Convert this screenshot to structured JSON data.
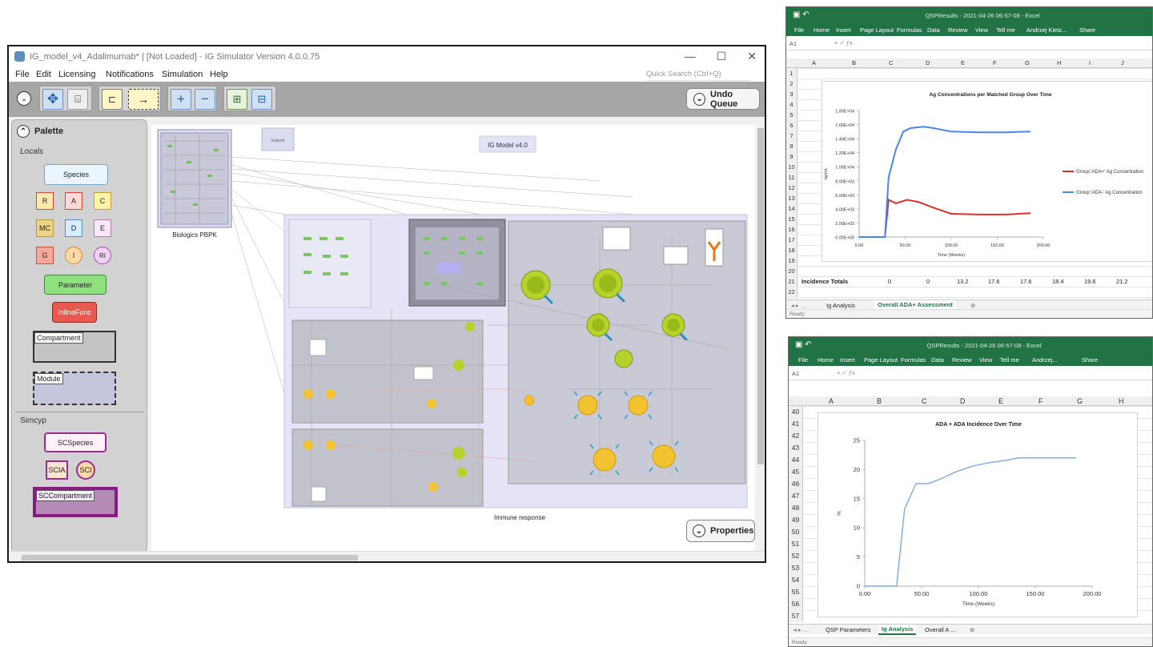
{
  "simulator": {
    "title": "IG_model_v4_Adalimumab* | [Not Loaded] - IG Simulator Version 4.0.0.75",
    "window_controls": [
      "—",
      "☐",
      "✕"
    ],
    "menu": [
      "File",
      "Edit",
      "Licensing",
      "Notifications",
      "Simulation",
      "Help"
    ],
    "quick_search_placeholder": "Quick Search (Ctrl+Q)",
    "undo_queue_label": "Undo Queue",
    "properties_label": "Properties",
    "palette": {
      "title": "Palette",
      "locals_label": "Locals",
      "species": "Species",
      "row1": [
        "R",
        "A",
        "C"
      ],
      "row2": [
        "MC",
        "D",
        "E"
      ],
      "row3": [
        "G",
        "I",
        "RI"
      ],
      "parameter": "Parameter",
      "inlinefunc": "InlineFunc",
      "compartment": "Compartment",
      "module": "Module",
      "simcyp_label": "Simcyp",
      "scspecies": "SCSpecies",
      "scia": "SCIA",
      "sci": "SCI",
      "sccompartment": "SCCompartment"
    },
    "canvas": {
      "model_title": "IG Model v4.0",
      "biologics_label": "Biologics PBPK",
      "immune_label": "Immune response",
      "small_box_label": "Subunit"
    }
  },
  "excel_top": {
    "title": "QSPResults - 2021-04-26 06-57-08 - Excel",
    "ribbon": [
      "File",
      "Home",
      "Insert",
      "Page Layout",
      "Formulas",
      "Data",
      "Review",
      "View",
      "Tell me",
      "Andrzej Kietz...",
      "Share"
    ],
    "name_box": "A1",
    "columns": [
      "A",
      "B",
      "C",
      "D",
      "E",
      "F",
      "G",
      "H",
      "I",
      "J"
    ],
    "rows": [
      "1",
      "2",
      "3",
      "4",
      "5",
      "6",
      "7",
      "8",
      "9",
      "10",
      "11",
      "12",
      "13",
      "14",
      "15",
      "16",
      "17",
      "18",
      "19",
      "20",
      "21",
      "22"
    ],
    "incidence_label": "Incidence Totals",
    "incidence_values": [
      "0",
      "0",
      "13.2",
      "17.6",
      "17.6",
      "18.4",
      "19.6",
      "21.2"
    ],
    "tabs": [
      "Ig Analysis",
      "Overall ADA+ Assessment"
    ],
    "active_tab": "Overall ADA+ Assessment",
    "status": "Ready"
  },
  "excel_bottom": {
    "title": "QSPResults - 2021-04-26 06-57-08 - Excel",
    "ribbon": [
      "File",
      "Home",
      "Insert",
      "Page Layout",
      "Formulas",
      "Data",
      "Review",
      "View",
      "Tell me",
      "Andrzej...",
      "Share"
    ],
    "name_box": "A1",
    "columns": [
      "A",
      "B",
      "C",
      "D",
      "E",
      "F",
      "G",
      "H"
    ],
    "rows": [
      "40",
      "41",
      "42",
      "43",
      "44",
      "45",
      "46",
      "47",
      "48",
      "49",
      "50",
      "51",
      "52",
      "53",
      "54",
      "55",
      "56",
      "57"
    ],
    "tabs": [
      "QSP Parameters",
      "Ig Analysis",
      "Overall A ..."
    ],
    "active_tab": "Ig Analysis",
    "status": "Ready"
  },
  "chart_data": [
    {
      "type": "line",
      "title": "Ag Concentrations per Matched Group Over Time",
      "xlabel": "Time (Weeks)",
      "ylabel": "ng/mL",
      "xlim": [
        0,
        200
      ],
      "ylim": [
        0,
        18000
      ],
      "xticks": [
        "0.00",
        "50.00",
        "100.00",
        "150.00",
        "200.00"
      ],
      "yticks": [
        "0.00E+00",
        "2.00E+03",
        "4.00E+03",
        "6.00E+03",
        "8.00E+03",
        "1.00E+04",
        "1.20E+04",
        "1.40E+04",
        "1.60E+04",
        "1.80E+04"
      ],
      "legend_position": "right",
      "series": [
        {
          "name": "Group:'ADA+' Ag Concentration",
          "color": "#d9302c",
          "x": [
            0,
            28,
            32,
            40,
            52,
            64,
            80,
            100,
            130,
            160,
            186
          ],
          "y": [
            0,
            0,
            5300,
            4800,
            5300,
            5000,
            4200,
            3300,
            3200,
            3200,
            3400
          ]
        },
        {
          "name": "Group:'ADA-' Ag Concentration",
          "color": "#4a86e8",
          "x": [
            0,
            28,
            32,
            40,
            48,
            56,
            70,
            80,
            100,
            130,
            160,
            186
          ],
          "y": [
            0,
            0,
            8500,
            12500,
            15000,
            15500,
            15700,
            15500,
            15000,
            14900,
            14900,
            15000
          ]
        }
      ]
    },
    {
      "type": "line",
      "title": "ADA + ADA Incidence Over Time",
      "xlabel": "Time (Weeks)",
      "ylabel": "%",
      "xlim": [
        0,
        200
      ],
      "ylim": [
        0,
        25
      ],
      "xticks": [
        "0.00",
        "50.00",
        "100.00",
        "150.00",
        "200.00"
      ],
      "yticks": [
        "0",
        "5",
        "10",
        "15",
        "20",
        "25"
      ],
      "series": [
        {
          "color": "#7fa7da",
          "x": [
            0,
            28,
            35,
            45,
            56,
            67,
            80,
            95,
            110,
            125,
            135,
            150,
            165,
            186
          ],
          "y": [
            0,
            0,
            13.2,
            17.6,
            17.6,
            18.4,
            19.6,
            20.6,
            21.2,
            21.6,
            22,
            22,
            22,
            22
          ]
        }
      ]
    }
  ]
}
